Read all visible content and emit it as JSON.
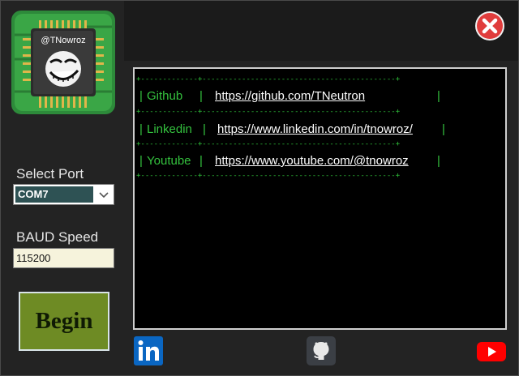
{
  "logo": {
    "text": "@TNowroz"
  },
  "port": {
    "label": "Select Port",
    "value": "COM7"
  },
  "baud": {
    "label": "BAUD Speed",
    "value": "115200"
  },
  "begin": {
    "label": "Begin"
  },
  "console": {
    "separator": "+-------------+--------------------------------------------+",
    "rows": [
      {
        "label": "Github",
        "link": "https://github.com/TNeutron"
      },
      {
        "label": "Linkedin",
        "link": "https://www.linkedin.com/in/tnowroz/"
      },
      {
        "label": "Youtube",
        "link": "https://www.youtube.com/@tnowroz"
      }
    ]
  },
  "pipe": "|",
  "icons": [
    "chip-logo-icon",
    "close-icon",
    "linkedin-icon",
    "github-icon",
    "youtube-icon"
  ],
  "colors": {
    "console_text": "#34c23e",
    "button": "#6e8b24",
    "close": "#e03c3c",
    "linkedin": "#0a66c2",
    "youtube": "#ff0000"
  }
}
